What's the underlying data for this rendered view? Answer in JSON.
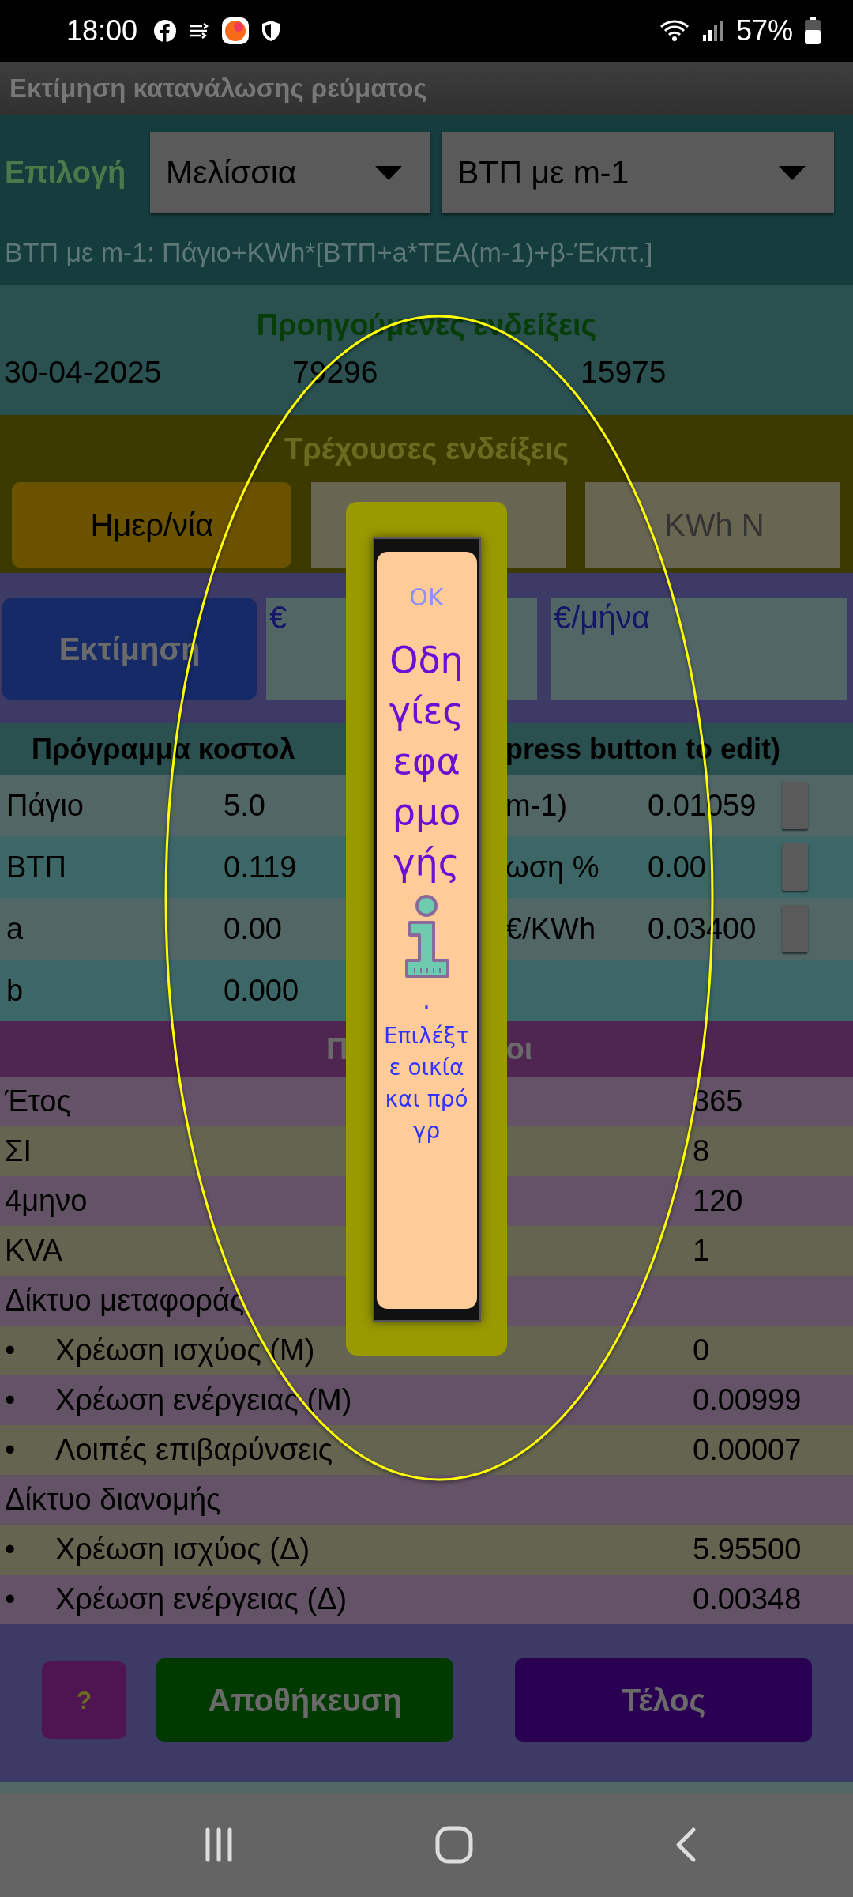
{
  "status_bar": {
    "time": "18:00",
    "battery": "57%"
  },
  "app_bar": {
    "title": "Εκτίμηση κατανάλωσης ρεύματος"
  },
  "selection": {
    "label": "Επιλογή",
    "house": "Μελίσσια",
    "plan": "ΒΤΠ με m-1"
  },
  "formula": "ΒΤΠ με m-1: Πάγιο+KWh*[ΒΤΠ+a*ΤΕΑ(m-1)+β-Έκπτ.]",
  "previous_readings": {
    "title": "Προηγούμενες ενδείξεις",
    "values": [
      "30-04-2025",
      "79296",
      "15975"
    ]
  },
  "current_readings": {
    "title": "Τρέχουσες ενδείξεις",
    "date_button": "Ημερ/νία",
    "night_field": {
      "placeholder": "KWh N"
    }
  },
  "estimate": {
    "button": "Εκτίμηση",
    "outputs": [
      "€",
      "€/μήνα"
    ]
  },
  "program_table": {
    "title_parts": [
      "Πρόγραμμα κοστολ",
      "press button to edit)"
    ],
    "rows": [
      {
        "label": "Πάγιο",
        "value": "5.0",
        "label_2": "m-1)",
        "value_2": "0.01059",
        "edit_button": true
      },
      {
        "label": "ΒΤΠ",
        "value": "0.119",
        "label_2": "ωση %",
        "value_2": "0.00",
        "edit_button": true
      },
      {
        "label": "a",
        "value": "0.00",
        "label_2": "€/KWh",
        "value_2": "0.03400",
        "edit_button": true
      },
      {
        "label": "b",
        "value": "0.000",
        "edit_button": false
      }
    ]
  },
  "parameters": {
    "title_parts": [
      "Π",
      "οι"
    ],
    "rows": [
      {
        "kind": "item",
        "label": "Έτος",
        "value": "365"
      },
      {
        "kind": "item",
        "label": "ΣΙ",
        "value": "8"
      },
      {
        "kind": "item",
        "label": "4μηνο",
        "value": "120"
      },
      {
        "kind": "item",
        "label": "KVA",
        "value": "1"
      },
      {
        "kind": "group",
        "label": "Δίκτυο μεταφοράς"
      },
      {
        "kind": "sub",
        "bullet": "•",
        "label": "Χρέωση ισχύος (Μ)",
        "value": "0"
      },
      {
        "kind": "sub",
        "bullet": "•",
        "label": "Χρέωση ενέργειας (Μ)",
        "value": "0.00999"
      },
      {
        "kind": "sub",
        "bullet": "•",
        "label": "Λοιπές επιβαρύνσεις",
        "value": "0.00007"
      },
      {
        "kind": "group",
        "label": "Δίκτυο διανομής"
      },
      {
        "kind": "sub",
        "bullet": "•",
        "label": "Χρέωση ισχύος (Δ)",
        "value": "5.95500"
      },
      {
        "kind": "sub",
        "bullet": "•",
        "label": "Χρέωση ενέργειας (Δ)",
        "value": "0.00348"
      }
    ]
  },
  "buttons": [
    {
      "kind": "help",
      "label": "?"
    },
    {
      "kind": "save",
      "label": "Αποθήκευση"
    },
    {
      "kind": "exit",
      "label": "Τέλος"
    }
  ],
  "dialog": {
    "ok": "OK",
    "title": "Οδηγίες εφαρμογής",
    "separator": ".",
    "message": "Επιλέξτε οικία και πρόγρ"
  }
}
